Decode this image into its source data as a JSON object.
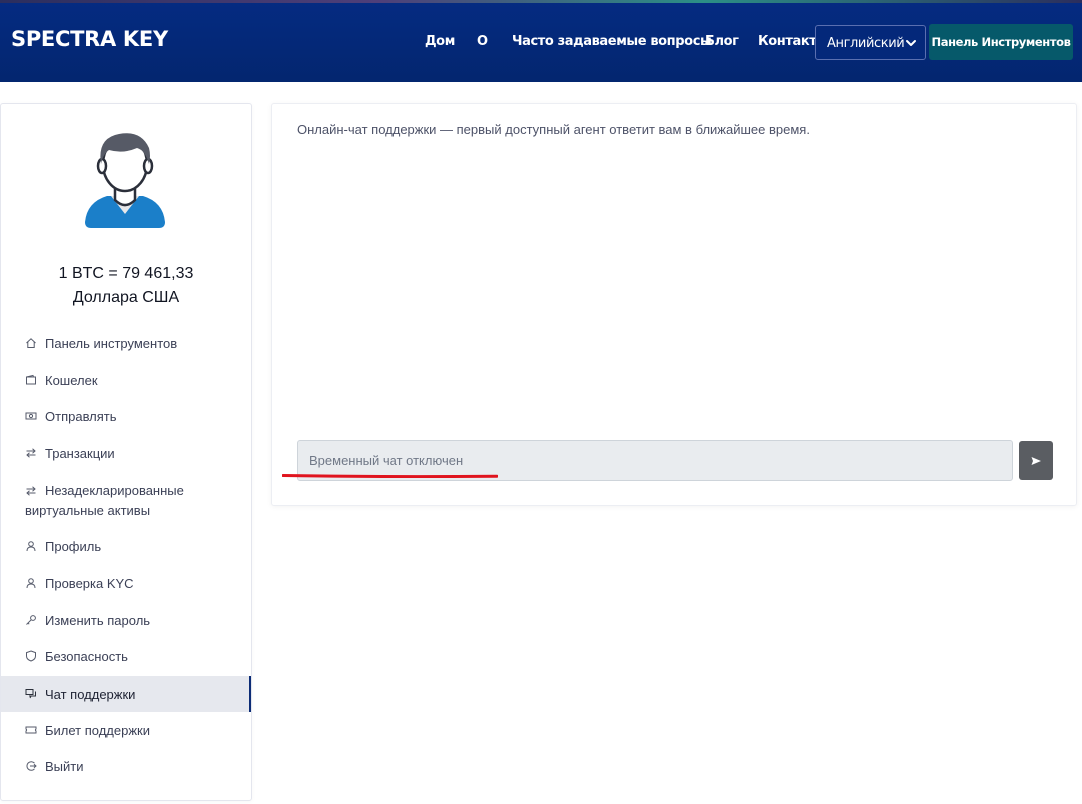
{
  "brand": {
    "logo_text": "SPECTRA KEY"
  },
  "nav": {
    "links": [
      "Дом",
      "О",
      "Часто задаваемые вопросы",
      "Блог",
      "Контакт"
    ],
    "language_selected": "Английский",
    "dashboard_button": "Панель Инструментов"
  },
  "sidebar": {
    "rate_line1": "1 BTC = 79 461,33",
    "rate_line2": "Доллара США",
    "items": [
      {
        "label": "Панель инструментов",
        "icon": "home-icon"
      },
      {
        "label": "Кошелек",
        "icon": "wallet-icon"
      },
      {
        "label": "Отправлять",
        "icon": "money-icon"
      },
      {
        "label": "Транзакции",
        "icon": "transfer-icon"
      },
      {
        "label": "Незадекларированные",
        "label2": "виртуальные активы",
        "icon": "transfer-icon"
      },
      {
        "label": "Профиль",
        "icon": "user-icon"
      },
      {
        "label": "Проверка KYC",
        "icon": "user-icon"
      },
      {
        "label": "Изменить пароль",
        "icon": "key-icon"
      },
      {
        "label": "Безопасность",
        "icon": "shield-icon"
      },
      {
        "label": "Чат поддержки",
        "icon": "chat-icon",
        "active": true
      },
      {
        "label": "Билет поддержки",
        "icon": "ticket-icon"
      },
      {
        "label": "Выйти",
        "icon": "logout-icon"
      }
    ]
  },
  "chat": {
    "intro": "Онлайн-чат поддержки — первый доступный агент ответит вам в ближайшее время.",
    "input_placeholder": "Временный чат отключен",
    "send_icon": "send-icon"
  },
  "colors": {
    "header_bg": "#04287a",
    "dashboard_button_bg": "#06596a",
    "send_button_bg": "#5a5d62",
    "annotation_red": "#e0141e",
    "active_item_bg": "#e6e8ee"
  }
}
